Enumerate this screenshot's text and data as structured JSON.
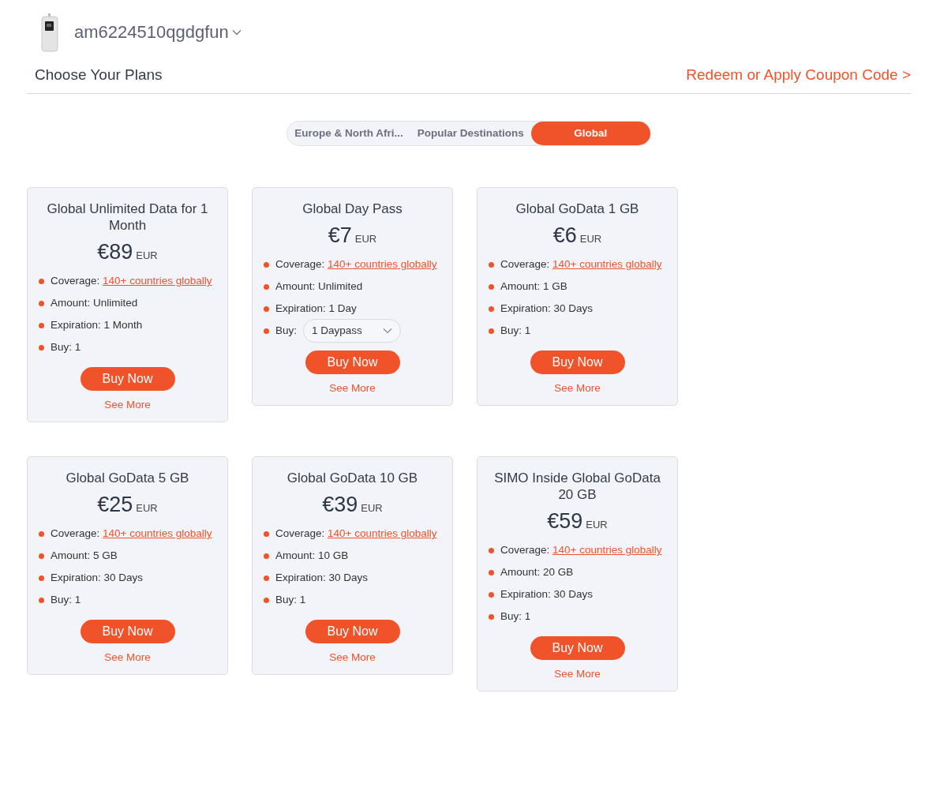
{
  "device": {
    "name": "am6224510qgdgfun"
  },
  "header": {
    "title": "Choose Your Plans",
    "coupon_link": "Redeem or Apply Coupon Code >"
  },
  "tabs": [
    {
      "label": "Europe & North Afri...",
      "selected": false
    },
    {
      "label": "Popular Destinations",
      "selected": false
    },
    {
      "label": "Global",
      "selected": true
    }
  ],
  "plans": [
    {
      "title": "Global Unlimited Data for 1 Month",
      "price": "€89",
      "currency": "EUR",
      "features": [
        {
          "kind": "link",
          "label": "Coverage:",
          "value": "140+ countries globally"
        },
        {
          "kind": "text",
          "label": "Amount:",
          "value": "Unlimited"
        },
        {
          "kind": "text",
          "label": "Expiration:",
          "value": "1 Month"
        },
        {
          "kind": "text",
          "label": "Buy:",
          "value": "1"
        }
      ],
      "button": "Buy Now",
      "more": "See More"
    },
    {
      "title": "Global Day Pass",
      "price": "€7",
      "currency": "EUR",
      "features": [
        {
          "kind": "link",
          "label": "Coverage:",
          "value": "140+ countries globally"
        },
        {
          "kind": "text",
          "label": "Amount:",
          "value": "Unlimited"
        },
        {
          "kind": "text",
          "label": "Expiration:",
          "value": "1 Day"
        },
        {
          "kind": "select",
          "label": "Buy:",
          "value": "1 Daypass"
        }
      ],
      "button": "Buy Now",
      "more": "See More"
    },
    {
      "title": "Global GoData 1 GB",
      "price": "€6",
      "currency": "EUR",
      "features": [
        {
          "kind": "link",
          "label": "Coverage:",
          "value": "140+ countries globally"
        },
        {
          "kind": "text",
          "label": "Amount:",
          "value": "1 GB"
        },
        {
          "kind": "text",
          "label": "Expiration:",
          "value": "30 Days"
        },
        {
          "kind": "text",
          "label": "Buy:",
          "value": "1"
        }
      ],
      "button": "Buy Now",
      "more": "See More"
    },
    {
      "title": "Global GoData 5 GB",
      "price": "€25",
      "currency": "EUR",
      "features": [
        {
          "kind": "link",
          "label": "Coverage:",
          "value": "140+ countries globally"
        },
        {
          "kind": "text",
          "label": "Amount:",
          "value": "5 GB"
        },
        {
          "kind": "text",
          "label": "Expiration:",
          "value": "30 Days"
        },
        {
          "kind": "text",
          "label": "Buy:",
          "value": "1"
        }
      ],
      "button": "Buy Now",
      "more": "See More"
    },
    {
      "title": "Global GoData 10 GB",
      "price": "€39",
      "currency": "EUR",
      "features": [
        {
          "kind": "link",
          "label": "Coverage:",
          "value": "140+ countries globally"
        },
        {
          "kind": "text",
          "label": "Amount:",
          "value": "10 GB"
        },
        {
          "kind": "text",
          "label": "Expiration:",
          "value": "30 Days"
        },
        {
          "kind": "text",
          "label": "Buy:",
          "value": "1"
        }
      ],
      "button": "Buy Now",
      "more": "See More"
    },
    {
      "title": "SIMO Inside Global GoData 20 GB",
      "price": "€59",
      "currency": "EUR",
      "features": [
        {
          "kind": "link",
          "label": "Coverage:",
          "value": "140+ countries globally"
        },
        {
          "kind": "text",
          "label": "Amount:",
          "value": "20 GB"
        },
        {
          "kind": "text",
          "label": "Expiration:",
          "value": "30 Days"
        },
        {
          "kind": "text",
          "label": "Buy:",
          "value": "1"
        }
      ],
      "button": "Buy Now",
      "more": "See More"
    }
  ]
}
